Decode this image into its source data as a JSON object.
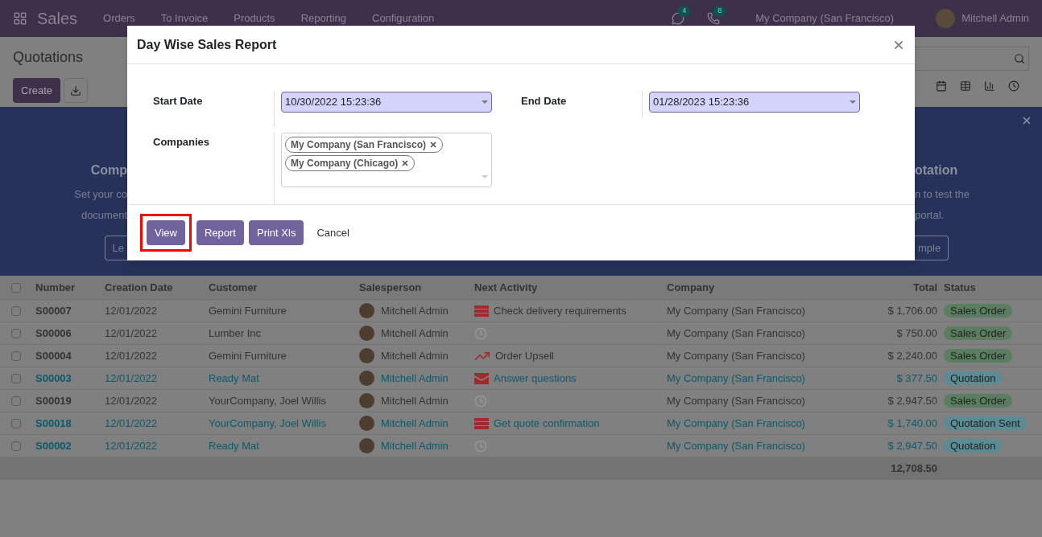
{
  "navbar": {
    "app": "Sales",
    "menu": [
      "Orders",
      "To Invoice",
      "Products",
      "Reporting",
      "Configuration"
    ],
    "chat_count": "4",
    "call_count": "8",
    "company": "My Company (San Francisco)",
    "user": "Mitchell Admin"
  },
  "control_panel": {
    "title": "Quotations",
    "create": "Create"
  },
  "banner": {
    "left_title": "Comp",
    "left_lines": [
      "Set your co",
      "document"
    ],
    "left_button": "Le",
    "right_title": "otation",
    "right_lines": [
      "n to test the",
      "portal."
    ],
    "right_button": "mple"
  },
  "table": {
    "select_all": false,
    "columns": [
      "Number",
      "Creation Date",
      "Customer",
      "Salesperson",
      "Next Activity",
      "Company",
      "Total",
      "Status"
    ],
    "rows": [
      {
        "checked": false,
        "highlighted": false,
        "number": "S00007",
        "date": "12/01/2022",
        "customer": "Gemini Furniture",
        "salesperson": "Mitchell Admin",
        "activity": {
          "kind": "todo",
          "text": "Check delivery requirements"
        },
        "company": "My Company (San Francisco)",
        "total": "$ 1,706.00",
        "status": {
          "label": "Sales Order",
          "color": "#5a7e5f"
        }
      },
      {
        "checked": false,
        "highlighted": false,
        "number": "S00006",
        "date": "12/01/2022",
        "customer": "Lumber Inc",
        "salesperson": "Mitchell Admin",
        "activity": {
          "kind": "none"
        },
        "company": "My Company (San Francisco)",
        "total": "$ 750.00",
        "status": {
          "label": "Sales Order",
          "color": "#5a7e5f"
        }
      },
      {
        "checked": false,
        "highlighted": false,
        "number": "S00004",
        "date": "12/01/2022",
        "customer": "Gemini Furniture",
        "salesperson": "Mitchell Admin",
        "activity": {
          "kind": "upsell",
          "text": "Order Upsell"
        },
        "company": "My Company (San Francisco)",
        "total": "$ 2,240.00",
        "status": {
          "label": "Sales Order",
          "color": "#5a7e5f"
        }
      },
      {
        "checked": false,
        "highlighted": true,
        "number": "S00003",
        "date": "12/01/2022",
        "customer": "Ready Mat",
        "salesperson": "Mitchell Admin",
        "activity": {
          "kind": "email",
          "text": "Answer questions"
        },
        "company": "My Company (San Francisco)",
        "total": "$ 377.50",
        "status": {
          "label": "Quotation",
          "color": "#5b8b94"
        }
      },
      {
        "checked": false,
        "highlighted": false,
        "number": "S00019",
        "date": "12/01/2022",
        "customer": "YourCompany, Joel Willis",
        "salesperson": "Mitchell Admin",
        "activity": {
          "kind": "none"
        },
        "company": "My Company (San Francisco)",
        "total": "$ 2,947.50",
        "status": {
          "label": "Sales Order",
          "color": "#5a7e5f"
        }
      },
      {
        "checked": false,
        "highlighted": true,
        "number": "S00018",
        "date": "12/01/2022",
        "customer": "YourCompany, Joel Willis",
        "salesperson": "Mitchell Admin",
        "activity": {
          "kind": "todo",
          "text": "Get quote confirmation"
        },
        "company": "My Company (San Francisco)",
        "total": "$ 1,740.00",
        "status": {
          "label": "Quotation Sent",
          "color": "#5b8b94"
        }
      },
      {
        "checked": false,
        "highlighted": true,
        "number": "S00002",
        "date": "12/01/2022",
        "customer": "Ready Mat",
        "salesperson": "Mitchell Admin",
        "activity": {
          "kind": "none"
        },
        "company": "My Company (San Francisco)",
        "total": "$ 2,947.50",
        "status": {
          "label": "Quotation",
          "color": "#5b8b94"
        }
      }
    ],
    "total": "12,708.50"
  },
  "dialog": {
    "title": "Day Wise Sales Report",
    "start_label": "Start Date",
    "start_value": "10/30/2022 15:23:36",
    "end_label": "End Date",
    "end_value": "01/28/2023 15:23:36",
    "companies_label": "Companies",
    "companies": [
      "My Company (San Francisco)",
      "My Company (Chicago)"
    ],
    "buttons": [
      {
        "label": "View",
        "kind": "primary",
        "outlined": true
      },
      {
        "label": "Report",
        "kind": "primary",
        "outlined": false
      },
      {
        "label": "Print Xls",
        "kind": "primary",
        "outlined": false
      },
      {
        "label": "Cancel",
        "kind": "link",
        "outlined": false
      }
    ]
  }
}
